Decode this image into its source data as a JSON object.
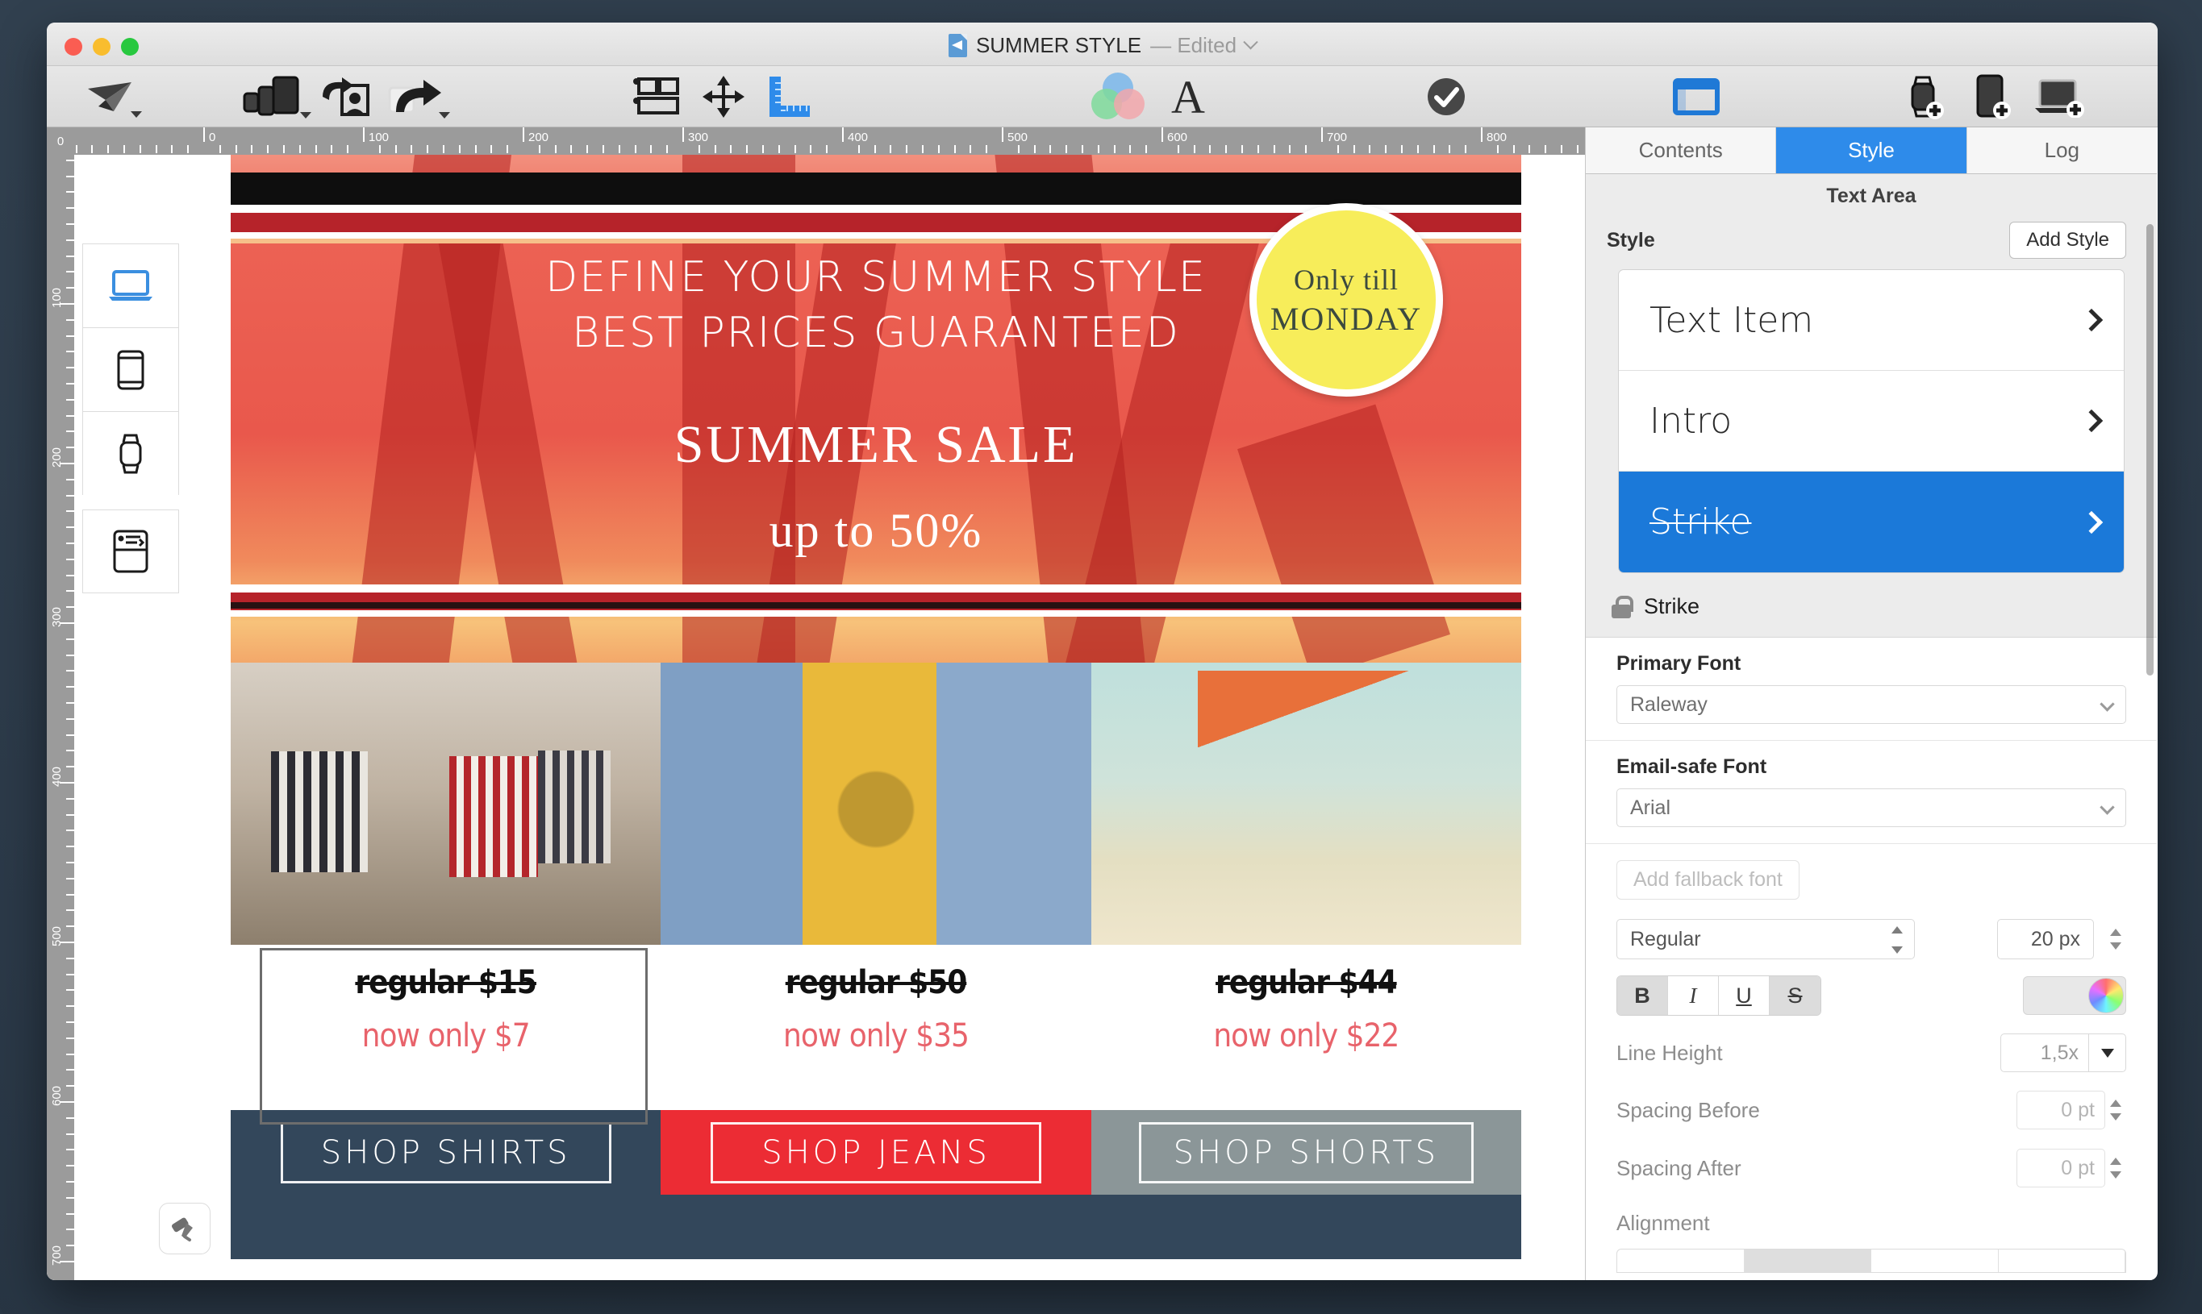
{
  "window": {
    "title": "SUMMER STYLE",
    "edited_suffix": "— Edited",
    "traffic_lights": [
      "close-red",
      "minimize-yellow",
      "zoom-green"
    ]
  },
  "toolbar": {
    "items": [
      {
        "name": "send-button",
        "label": "Send",
        "icon": "paper-plane-icon",
        "has_caret": true
      },
      {
        "name": "devices-preview-button",
        "label": "Devices",
        "icon": "devices-icon",
        "has_caret": true
      },
      {
        "name": "personalize-button",
        "label": "Personalize",
        "icon": "personalize-image-icon",
        "has_caret": false
      },
      {
        "name": "share-button",
        "label": "Share",
        "icon": "share-arrow-icon",
        "has_caret": true
      },
      {
        "name": "arrange-button",
        "label": "Arrange",
        "icon": "arrange-layout-icon",
        "has_caret": false
      },
      {
        "name": "move-button",
        "label": "Move",
        "icon": "move-arrows-icon",
        "has_caret": false
      },
      {
        "name": "rulers-button",
        "label": "Rulers",
        "icon": "ruler-icon",
        "has_caret": false,
        "active": true
      },
      {
        "name": "colors-button",
        "label": "Colors",
        "icon": "color-wheel-icon",
        "has_caret": false
      },
      {
        "name": "fonts-button",
        "label": "Fonts",
        "icon": "letter-a-icon",
        "has_caret": false
      },
      {
        "name": "validate-button",
        "label": "Validate",
        "icon": "checkmark-circle-icon",
        "has_caret": false
      },
      {
        "name": "inspector-toggle-button",
        "label": "Inspector",
        "icon": "panel-window-icon",
        "has_caret": false,
        "active": true
      },
      {
        "name": "add-watch-layout-button",
        "label": "Add Watch Layout",
        "icon": "watch-plus-icon",
        "has_caret": false
      },
      {
        "name": "add-mobile-layout-button",
        "label": "Add Mobile Layout",
        "icon": "phone-plus-icon",
        "has_caret": false
      },
      {
        "name": "add-desktop-layout-button",
        "label": "Add Desktop Layout",
        "icon": "laptop-plus-icon",
        "has_caret": false
      }
    ]
  },
  "rulers": {
    "corner_label": "0",
    "horizontal_labels": [
      "0",
      "100",
      "200",
      "300",
      "400",
      "500",
      "600",
      "700",
      "800"
    ],
    "vertical_labels": [
      "100",
      "200",
      "300",
      "400",
      "500",
      "600"
    ]
  },
  "device_sidebar": {
    "items": [
      {
        "name": "layout-desktop",
        "icon": "laptop-icon",
        "active": true
      },
      {
        "name": "layout-mobile",
        "icon": "phone-icon",
        "active": false
      },
      {
        "name": "layout-watch",
        "icon": "watch-icon",
        "active": false
      },
      {
        "name": "layout-plaintext",
        "icon": "plaintext-icon",
        "active": false
      }
    ],
    "paint_tool": {
      "name": "paint-roller-tool",
      "icon": "paint-roller-icon"
    }
  },
  "design": {
    "hero": {
      "headline_line1": "DEFINE YOUR SUMMER STYLE",
      "headline_line2": "BEST PRICES GUARANTEED",
      "sale_title": "SUMMER SALE",
      "sale_subtitle": "up to 50%",
      "badge_line1": "Only till",
      "badge_line2": "MONDAY",
      "badge_color": "#f7ed5a"
    },
    "products": [
      {
        "name": "product-shirts",
        "alt": "hanging striped shirts on a clothesline"
      },
      {
        "name": "product-jeans",
        "alt": "denim shorts hands forming a heart"
      },
      {
        "name": "product-shorts",
        "alt": "man in orange swim shorts at the beach"
      }
    ],
    "prices": [
      {
        "regular": "regular $15",
        "now": "now only $7",
        "selected": true
      },
      {
        "regular": "regular $50",
        "now": "now only $35",
        "selected": false
      },
      {
        "regular": "regular $44",
        "now": "now only $22",
        "selected": false
      }
    ],
    "shop_buttons": [
      {
        "label": "SHOP SHIRTS",
        "bg": "#33475b"
      },
      {
        "label": "SHOP JEANS",
        "bg": "#ec2c34"
      },
      {
        "label": "SHOP SHORTS",
        "bg": "#8b9698"
      }
    ],
    "price_color": "#e8636b"
  },
  "inspector": {
    "tabs": [
      {
        "label": "Contents",
        "active": false
      },
      {
        "label": "Style",
        "active": true
      },
      {
        "label": "Log",
        "active": false
      }
    ],
    "panel_title": "Text Area",
    "style_section_label": "Style",
    "add_style_label": "Add Style",
    "style_list": [
      {
        "label": "Text Item",
        "selected": false
      },
      {
        "label": "Intro",
        "selected": false
      },
      {
        "label": "Strike",
        "selected": true
      }
    ],
    "locked_style_name": "Strike",
    "primary_font_label": "Primary Font",
    "primary_font_value": "Raleway",
    "email_safe_font_label": "Email-safe Font",
    "email_safe_font_value": "Arial",
    "add_fallback_label": "Add fallback font",
    "weight_value": "Regular",
    "size_value": "20 px",
    "format_buttons": [
      {
        "name": "bold",
        "glyph": "B",
        "on": true
      },
      {
        "name": "italic",
        "glyph": "I",
        "on": false
      },
      {
        "name": "underline",
        "glyph": "U",
        "on": false
      },
      {
        "name": "strikethrough",
        "glyph": "S",
        "on": true
      }
    ],
    "line_height_label": "Line Height",
    "line_height_value": "1,5x",
    "spacing_before_label": "Spacing Before",
    "spacing_before_value": "0 pt",
    "spacing_after_label": "Spacing After",
    "spacing_after_value": "0 pt",
    "alignment_label": "Alignment",
    "accent_color": "#2e8bea",
    "selected_row_color": "#1b79d9"
  }
}
